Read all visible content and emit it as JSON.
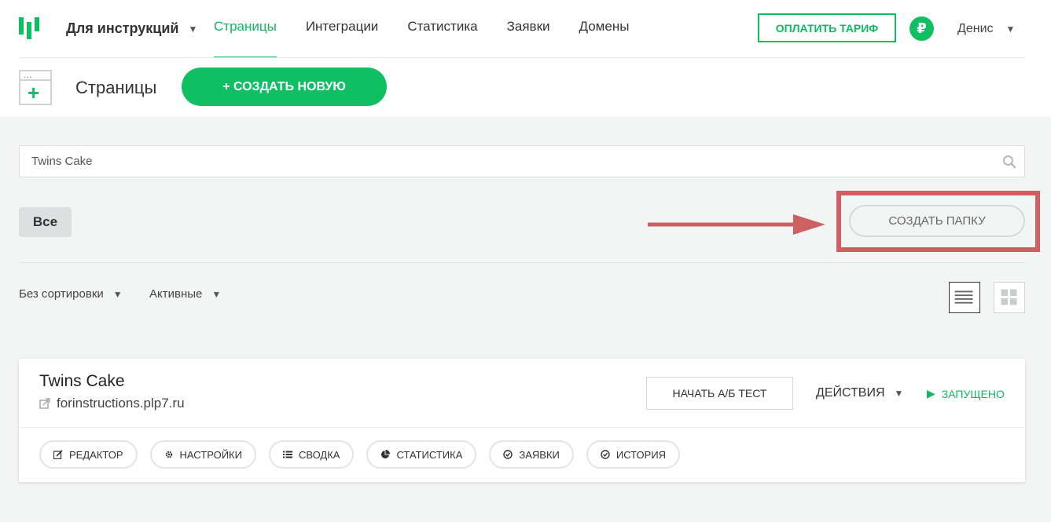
{
  "nav": {
    "workspace": "Для инструкций",
    "links": [
      {
        "label": "Страницы",
        "active": true
      },
      {
        "label": "Интеграции",
        "active": false
      },
      {
        "label": "Статистика",
        "active": false
      },
      {
        "label": "Заявки",
        "active": false
      },
      {
        "label": "Домены",
        "active": false
      }
    ],
    "pay_label": "ОПЛАТИТЬ ТАРИФ",
    "currency_symbol": "₽",
    "user_name": "Денис"
  },
  "header": {
    "title": "Страницы",
    "create_label": "+ СОЗДАТЬ НОВУЮ"
  },
  "search": {
    "value": "Twins Cake"
  },
  "filters": {
    "all_label": "Все",
    "create_folder_label": "СОЗДАТЬ ПАПКУ",
    "sort_label": "Без сортировки",
    "status_label": "Активные"
  },
  "card": {
    "title": "Twins Cake",
    "url": "forinstructions.plp7.ru",
    "ab_label": "НАЧАТЬ А/Б ТЕСТ",
    "actions_label": "ДЕЙСТВИЯ",
    "status_label": "ЗАПУЩЕНО",
    "tools": [
      {
        "label": "РЕДАКТОР",
        "icon": "edit-icon"
      },
      {
        "label": "НАСТРОЙКИ",
        "icon": "gear-icon"
      },
      {
        "label": "СВОДКА",
        "icon": "list-icon"
      },
      {
        "label": "СТАТИСТИКА",
        "icon": "pie-chart-icon"
      },
      {
        "label": "ЗАЯВКИ",
        "icon": "check-circle-icon"
      },
      {
        "label": "ИСТОРИЯ",
        "icon": "check-circle-icon"
      }
    ]
  },
  "colors": {
    "accent": "#0fc063",
    "annotation": "#cf6061"
  }
}
